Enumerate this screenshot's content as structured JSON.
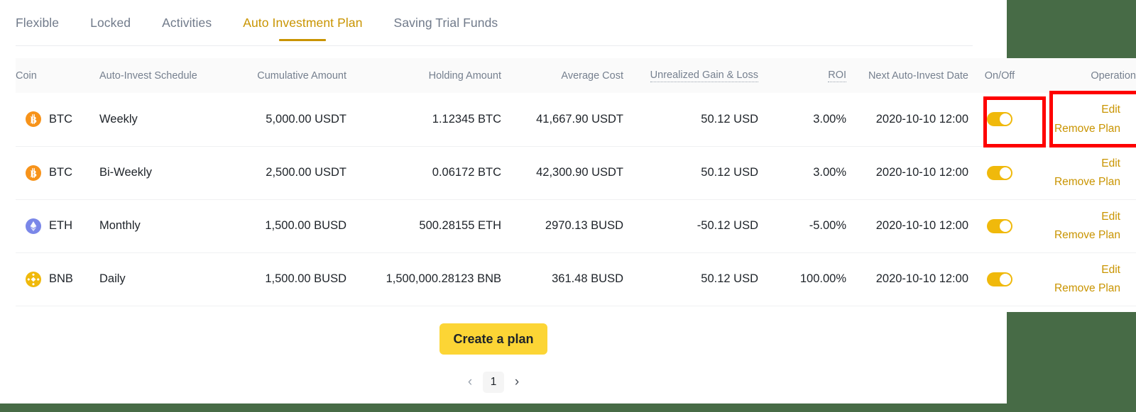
{
  "theme": {
    "accent": "#c99400",
    "brand_yellow": "#fcd535",
    "toggle_on": "#f0b90b",
    "positive": "#0ecb81",
    "negative": "#f6465d",
    "annotation": "#fe0000",
    "page_background": "#476b46"
  },
  "tabs": [
    {
      "label": "Flexible",
      "active": false
    },
    {
      "label": "Locked",
      "active": false
    },
    {
      "label": "Activities",
      "active": false
    },
    {
      "label": "Auto Investment Plan",
      "active": true
    },
    {
      "label": "Saving Trial Funds",
      "active": false
    }
  ],
  "table": {
    "columns": [
      {
        "key": "coin",
        "label": "Coin",
        "tooltip": false
      },
      {
        "key": "schedule",
        "label": "Auto-Invest Schedule",
        "tooltip": false
      },
      {
        "key": "cumulative",
        "label": "Cumulative Amount",
        "tooltip": false
      },
      {
        "key": "holding",
        "label": "Holding Amount",
        "tooltip": false
      },
      {
        "key": "average",
        "label": "Average Cost",
        "tooltip": false
      },
      {
        "key": "ugl",
        "label": "Unrealized Gain & Loss",
        "tooltip": true
      },
      {
        "key": "roi",
        "label": "ROI",
        "tooltip": true
      },
      {
        "key": "next",
        "label": "Next Auto-Invest Date",
        "tooltip": false
      },
      {
        "key": "onoff",
        "label": "On/Off",
        "tooltip": false
      },
      {
        "key": "operation",
        "label": "Operation",
        "tooltip": false
      }
    ],
    "rows": [
      {
        "coin": "BTC",
        "coin_icon": "bitcoin-icon",
        "schedule": "Weekly",
        "cumulative": "5,000.00 USDT",
        "holding": "1.12345 BTC",
        "average": "41,667.90 USDT",
        "ugl": "50.12 USD",
        "ugl_sign": "positive",
        "roi": "3.00%",
        "roi_sign": "positive",
        "next": "2020-10-10 12:00",
        "toggle_on": true,
        "edit_label": "Edit",
        "remove_label": "Remove Plan"
      },
      {
        "coin": "BTC",
        "coin_icon": "bitcoin-icon",
        "schedule": "Bi-Weekly",
        "cumulative": "2,500.00 USDT",
        "holding": "0.06172 BTC",
        "average": "42,300.90 USDT",
        "ugl": "50.12 USD",
        "ugl_sign": "positive",
        "roi": "3.00%",
        "roi_sign": "positive",
        "next": "2020-10-10 12:00",
        "toggle_on": true,
        "edit_label": "Edit",
        "remove_label": "Remove Plan"
      },
      {
        "coin": "ETH",
        "coin_icon": "ethereum-icon",
        "schedule": "Monthly",
        "cumulative": "1,500.00 BUSD",
        "holding": "500.28155 ETH",
        "average": "2970.13 BUSD",
        "ugl": "-50.12 USD",
        "ugl_sign": "negative",
        "roi": "-5.00%",
        "roi_sign": "negative",
        "next": "2020-10-10 12:00",
        "toggle_on": true,
        "edit_label": "Edit",
        "remove_label": "Remove Plan"
      },
      {
        "coin": "BNB",
        "coin_icon": "binance-icon",
        "schedule": "Daily",
        "cumulative": "1,500.00 BUSD",
        "holding": "1,500,000.28123 BNB",
        "average": "361.48 BUSD",
        "ugl": "50.12 USD",
        "ugl_sign": "positive",
        "roi": "100.00%",
        "roi_sign": "positive",
        "next": "2020-10-10 12:00",
        "toggle_on": true,
        "edit_label": "Edit",
        "remove_label": "Remove Plan"
      }
    ]
  },
  "footer": {
    "create_plan_label": "Create a plan",
    "pagination": {
      "prev_glyph": "‹",
      "next_glyph": "›",
      "current_page": "1"
    }
  },
  "annotations": [
    {
      "name": "toggle-highlight",
      "target": "On/Off toggle of first row"
    },
    {
      "name": "operation-highlight",
      "target": "Edit / Remove Plan links of first row"
    }
  ]
}
